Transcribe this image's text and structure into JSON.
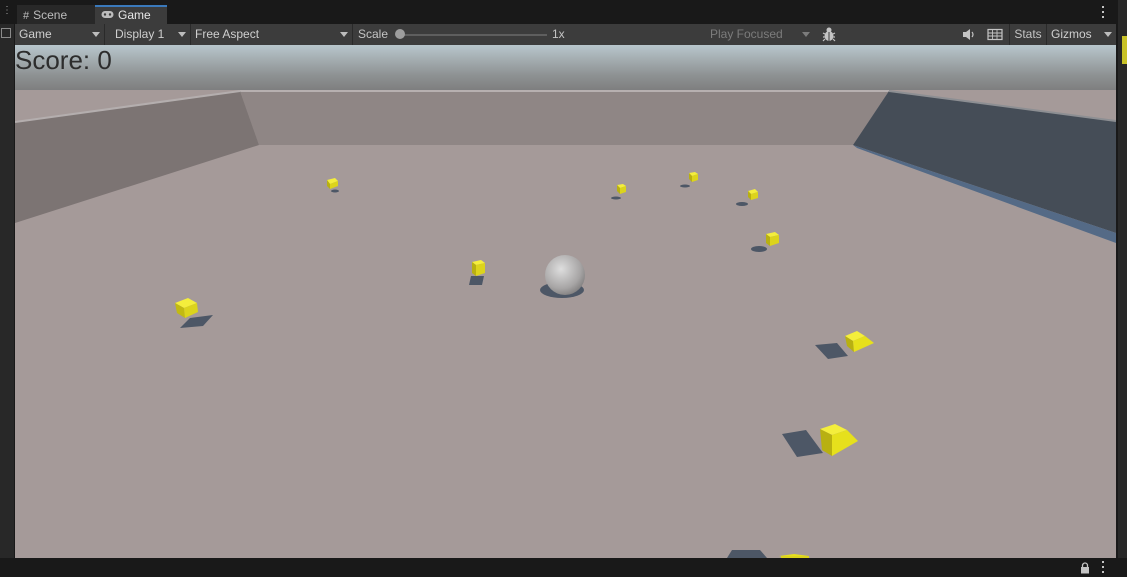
{
  "tabs": [
    {
      "label": "Scene",
      "icon": "grid-icon"
    },
    {
      "label": "Game",
      "icon": "gamepad-icon"
    }
  ],
  "toolbar": {
    "game_view": "Game",
    "display": "Display 1",
    "aspect": "Free Aspect",
    "scale_label": "Scale",
    "scale_value": "1x",
    "play_mode": "Play Focused",
    "stats_label": "Stats",
    "gizmos_label": "Gizmos"
  },
  "game": {
    "score_text": "Score: 0"
  },
  "colors": {
    "accent_tab": "#3a79bb",
    "floor": "#a59a99",
    "pickup": "#e6e01c",
    "panel_bg": "#3c3c3c"
  }
}
